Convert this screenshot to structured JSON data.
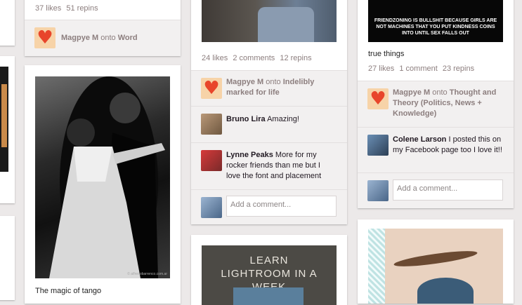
{
  "col1_top": {
    "stats": {
      "likes": "37 likes",
      "repins": "51 repins"
    },
    "attribution": {
      "user": "Magpye M",
      "onto": "onto",
      "board": "Word"
    }
  },
  "col2_top": {
    "stats": {
      "likes": "24 likes",
      "comments": "2 comments",
      "repins": "12 repins"
    },
    "attribution": {
      "user": "Magpye M",
      "onto": "onto",
      "board": "Indelibly marked for life"
    },
    "comments": [
      {
        "user": "Bruno Lira",
        "text": "Amazing!"
      },
      {
        "user": "Lynne Peaks",
        "text": "More for my rocker friends than me but I love the font and placement"
      }
    ],
    "comment_placeholder": "Add a comment..."
  },
  "col2_bottom": {
    "image_text": "LEARN LIGHTROOM IN A WEEK"
  },
  "col3_top": {
    "meme_text": "FRIENDZONING IS BULLSHIT BECAUSE GIRLS ARE NOT MACHINES THAT YOU PUT KINDNESS COINS INTO UNTIL SEX FALLS OUT",
    "description": "true things",
    "stats": {
      "likes": "27 likes",
      "comments": "1 comment",
      "repins": "23 repins"
    },
    "attribution": {
      "user": "Magpye M",
      "onto": "onto",
      "board": "Thought and Theory (Politics, News + Knowledge)"
    },
    "comments": [
      {
        "user": "Colene Larson",
        "text": "I posted this on my Facebook page too I love it!!"
      }
    ],
    "comment_placeholder": "Add a comment..."
  },
  "col1_tango": {
    "description": "The magic of tango",
    "watermark": "© alfredobarrenco.com.ar"
  },
  "colors": {
    "background": "#ece9e9",
    "card": "#ffffff",
    "muted": "#8c7e7e",
    "heart": "#e8452b"
  }
}
